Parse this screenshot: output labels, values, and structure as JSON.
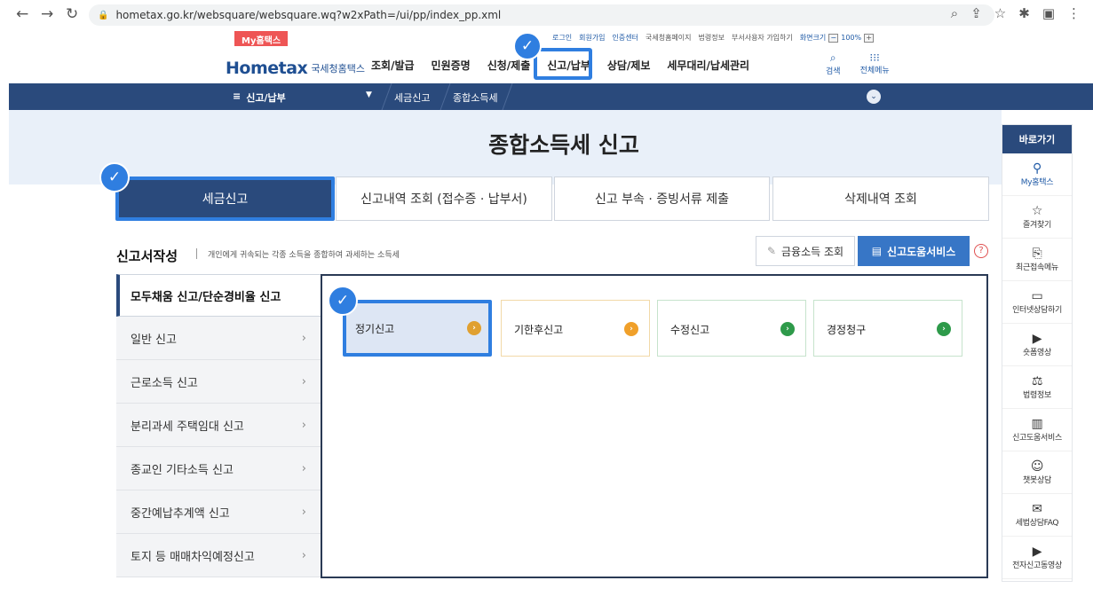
{
  "browser": {
    "url": "hometax.go.kr/websquare/websquare.wq?w2xPath=/ui/pp/index_pp.xml",
    "icons": [
      "back-icon",
      "forward-icon",
      "reload-icon",
      "lock-icon",
      "zoom-icon",
      "share-icon",
      "star-icon",
      "extensions-icon",
      "sidebar-icon",
      "menu-kebab-icon"
    ]
  },
  "header": {
    "my_hometax": "My홈택스",
    "logo_text": "Hometax",
    "logo_sub": "국세청홈택스",
    "util_links": [
      "로그인",
      "회원가입",
      "인증센터",
      "국세청홈페이지",
      "법령정보",
      "부서사용자 가입하기",
      "화면크기"
    ],
    "zoom": "100%",
    "gnb": [
      "조회/발급",
      "민원증명",
      "신청/제출",
      "신고/납부",
      "상담/제보",
      "세무대리/납세관리"
    ],
    "search_label": "검색",
    "all_menu_label": "전체메뉴"
  },
  "breadcrumb": {
    "menu": "신고/납부",
    "level1": "세금신고",
    "level2": "종합소득세"
  },
  "page_title": "종합소득세 신고",
  "tabs": [
    "세금신고",
    "신고내역 조회 (접수증 · 납부서)",
    "신고 부속 · 증빙서류 제출",
    "삭제내역 조회"
  ],
  "section": {
    "title": "신고서작성",
    "desc": "개인에게 귀속되는 각종 소득을 종합하여 과세하는 소득세",
    "finance_btn": "금융소득 조회",
    "help_service_btn": "신고도움서비스",
    "help_q": "?"
  },
  "side_menu": {
    "head": "모두채움 신고/단순경비율 신고",
    "items": [
      "일반 신고",
      "근로소득 신고",
      "분리과세 주택임대 신고",
      "종교인 기타소득 신고",
      "중간예납추계액 신고",
      "토지 등 매매차익예정신고"
    ]
  },
  "cards": [
    {
      "label": "정기신고",
      "color": "#e0a030"
    },
    {
      "label": "기한후신고",
      "color": "#f0a02a"
    },
    {
      "label": "수정신고",
      "color": "#2e9a4a"
    },
    {
      "label": "경정청구",
      "color": "#2e9a4a"
    }
  ],
  "quick_menu": {
    "head": "바로가기",
    "items": [
      "My홈택스",
      "즐겨찾기",
      "최근접속메뉴",
      "인터넷상담하기",
      "숏폼영상",
      "법령정보",
      "신고도움서비스",
      "챗봇상담",
      "세법상담FAQ",
      "전자신고동영상"
    ]
  },
  "colors": {
    "navy": "#2a4a7c",
    "highlight": "#2f7ee0",
    "accent_blue": "#3776c6"
  }
}
